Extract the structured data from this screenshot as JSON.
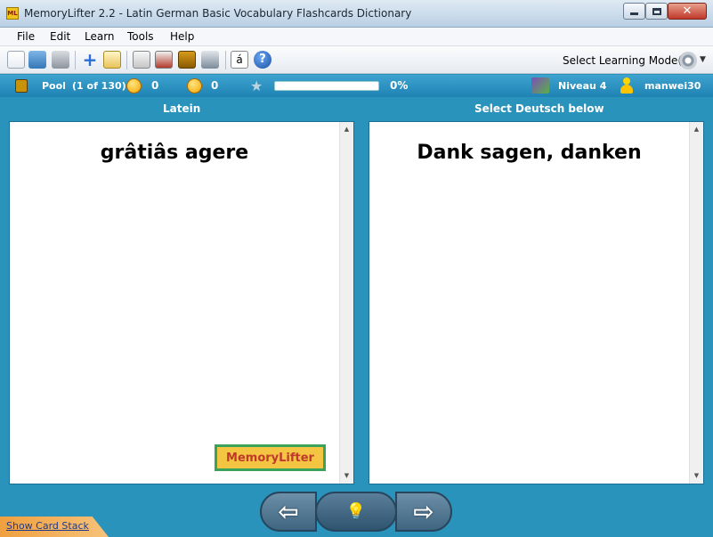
{
  "window": {
    "title": "MemoryLifter 2.2 - Latin German Basic Vocabulary Flashcards Dictionary",
    "app_icon_text": "ML",
    "controls": {
      "minimize": "minimize",
      "maximize": "maximize",
      "close": "✕"
    }
  },
  "menu": {
    "items": [
      "File",
      "Edit",
      "Learn",
      "Tools",
      "Help"
    ]
  },
  "toolbar": {
    "icons": [
      "new-file-icon",
      "open-folder-icon",
      "print-icon",
      "add-card-icon",
      "edit-icon",
      "slideshow-icon",
      "statistics-icon",
      "dictionary-icon",
      "settings-tools-icon",
      "special-char-icon",
      "help-icon"
    ],
    "special_char_label": "á",
    "help_label": "?",
    "mode_label": "Select Learning Mode(s)"
  },
  "status": {
    "pool_label": "Pool",
    "pool_count": "(1 of 130)",
    "correct_count": "0",
    "wrong_count": "0",
    "progress_percent": 0,
    "progress_text": "0%",
    "level_label": "Niveau 4",
    "user_name": "manwei30"
  },
  "columns": {
    "left_header": "Latein",
    "right_header": "Select Deutsch below"
  },
  "cards": {
    "question": "grâtiâs agere",
    "answer": "Dank sagen, danken"
  },
  "logo": {
    "text": "MemoryLifter"
  },
  "navigation": {
    "back_symbol": "⇦",
    "hint_symbol": "💡",
    "forward_symbol": "⇨"
  },
  "footer": {
    "card_stack_link": "Show Card Stack"
  },
  "colors": {
    "background": "#2a93bb",
    "status_bar": "#1e83b3",
    "progress_fill": "#4caf50",
    "card_stack_tab": "#f0a040"
  }
}
